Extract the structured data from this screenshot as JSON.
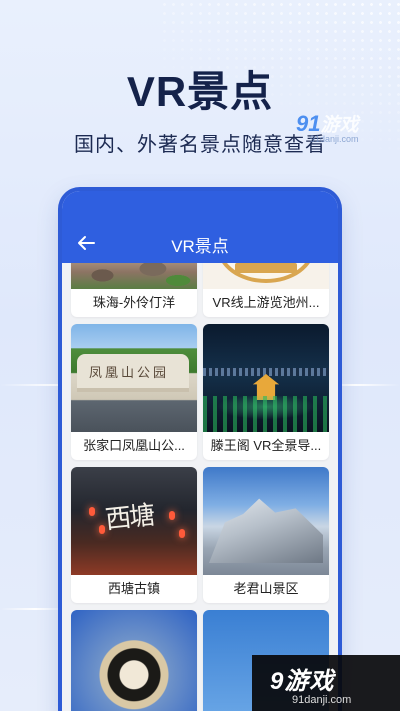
{
  "hero": {
    "title": "VR景点",
    "subtitle": "国内、外著名景点随意查看"
  },
  "watermark_top": {
    "num": "91",
    "text": "游戏",
    "url": "91danji.com"
  },
  "appbar": {
    "back_icon": "arrow-left-icon",
    "title": "VR景点"
  },
  "cards": [
    {
      "caption": "珠海-外伶仃洋",
      "thumb": "rocks"
    },
    {
      "caption": "VR线上游览池州...",
      "thumb": "badge"
    },
    {
      "caption": "张家口凤凰山公...",
      "thumb": "park",
      "image_text": "凤凰山公园"
    },
    {
      "caption": "滕王阁 VR全景导...",
      "thumb": "night"
    },
    {
      "caption": "西塘古镇",
      "thumb": "town",
      "image_text": "西塘"
    },
    {
      "caption": "老君山景区",
      "thumb": "mount"
    },
    {
      "caption": "",
      "thumb": "globe"
    },
    {
      "caption": "",
      "thumb": "sky"
    }
  ],
  "watermark_bottom": {
    "num": "9",
    "text": "游戏",
    "url": "91danji.com"
  },
  "colors": {
    "appbar": "#2f5fe0",
    "hero_text": "#14224a",
    "list_background": "#f1f2f5"
  }
}
